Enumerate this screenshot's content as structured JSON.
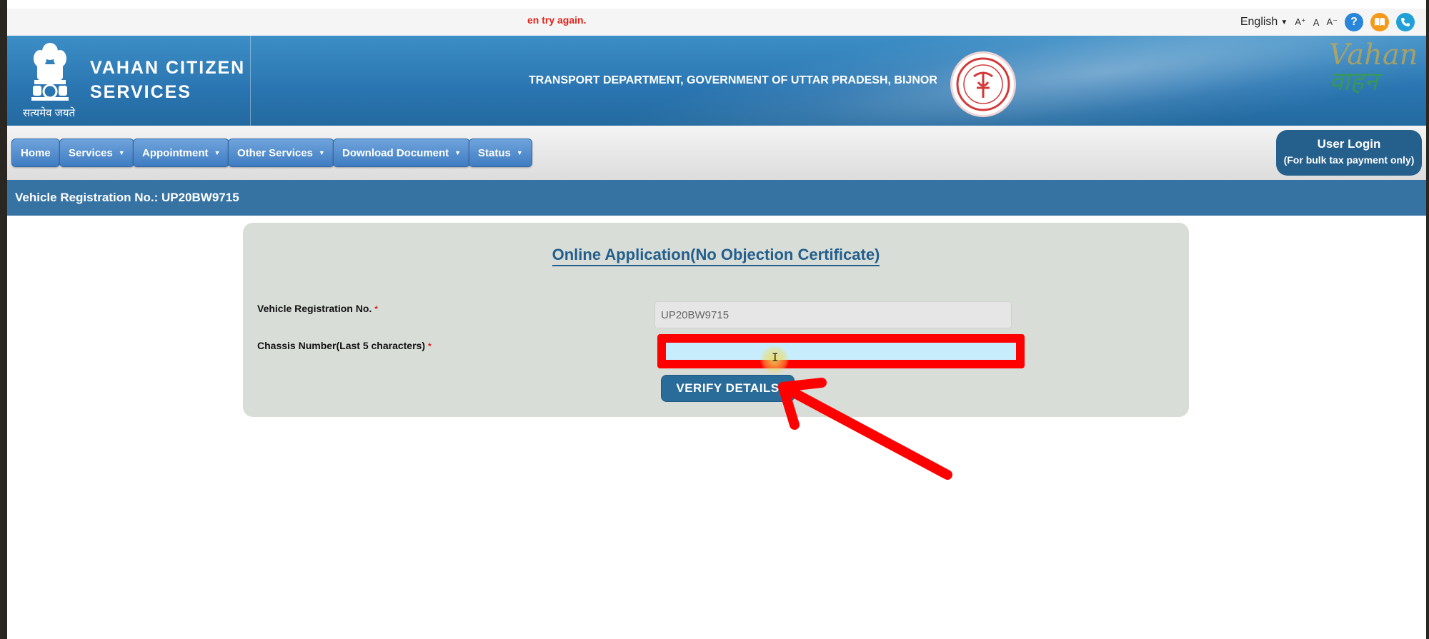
{
  "topbar": {
    "error_text": "en try again.",
    "language": "English",
    "font_increase": "A⁺",
    "font_normal": "A",
    "font_decrease": "A⁻",
    "help_icon_glyph": "?",
    "icons": [
      "help-icon",
      "book-icon",
      "phone-icon"
    ]
  },
  "header": {
    "site_title_line1": "VAHAN CITIZEN",
    "site_title_line2": "SERVICES",
    "motto": "सत्यमेव जयते",
    "department": "TRANSPORT DEPARTMENT, GOVERNMENT OF UTTAR PRADESH, BIJNOR",
    "logo_en": "Vahan",
    "logo_hi": "वाहन"
  },
  "nav": {
    "items": [
      {
        "label": "Home",
        "dropdown": false
      },
      {
        "label": "Services",
        "dropdown": true
      },
      {
        "label": "Appointment",
        "dropdown": true
      },
      {
        "label": "Other Services",
        "dropdown": true
      },
      {
        "label": "Download Document",
        "dropdown": true
      },
      {
        "label": "Status",
        "dropdown": true
      }
    ],
    "user_login": "User Login",
    "user_login_sub": "(For bulk tax payment only)"
  },
  "regbar": {
    "text": "Vehicle Registration No.: UP20BW9715"
  },
  "form": {
    "title": "Online Application(No Objection Certificate)",
    "reg_label": "Vehicle Registration No.",
    "reg_value": "UP20BW9715",
    "chassis_label": "Chassis Number(Last 5 characters)",
    "chassis_value": "",
    "required_mark": "*",
    "verify_button": "VERIFY DETAILS"
  },
  "colors": {
    "header_blue": "#2a75b1",
    "reg_bar": "#3673a3",
    "button_blue": "#2a6c99",
    "highlight_red": "#ff0000",
    "error_red": "#e0221b"
  }
}
